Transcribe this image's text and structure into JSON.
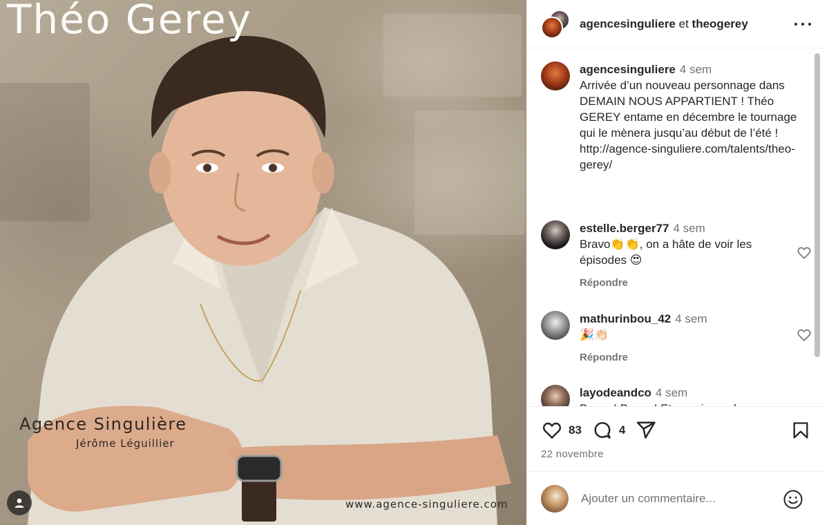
{
  "photo": {
    "title": "Théo Gerey",
    "agency_name": "Agence Singulière",
    "agency_person": "Jérôme Léguillier",
    "agency_url": "www.agence-singuliere.com"
  },
  "header": {
    "user1": "agencesinguliere",
    "separator": "et",
    "user2": "theogerey"
  },
  "post": {
    "username": "agencesinguliere",
    "time": "4 sem",
    "caption": "Arrivée d’un nouveau personnage dans DEMAIN NOUS APPARTIENT ! Théo GEREY entame en décembre le tournage qui le mènera jusqu’au début de l’été !\nhttp://agence-singuliere.com/talents/theo-gerey/"
  },
  "comments": [
    {
      "username": "estelle.berger77",
      "time": "4 sem",
      "text": "Bravo👏👏, on a hâte de voir les épisodes 😍",
      "reply": "Répondre"
    },
    {
      "username": "mathurinbou_42",
      "time": "4 sem",
      "text": "🎉👏🏻",
      "reply": "Répondre"
    },
    {
      "username": "layodeandco",
      "time": "4 sem",
      "text": "Bravo ! Bravo ! Et merci pour le ..."
    }
  ],
  "actions": {
    "likes": "83",
    "comments": "4",
    "date": "22 novembre"
  },
  "comment_box": {
    "placeholder": "Ajouter un commentaire..."
  },
  "icons": {
    "like": "heart-icon",
    "comment": "comment-bubble-icon",
    "share": "paper-plane-icon",
    "save": "bookmark-icon",
    "more": "more-horizontal-icon",
    "emoji": "smiley-icon",
    "tag": "user-tag-icon"
  }
}
